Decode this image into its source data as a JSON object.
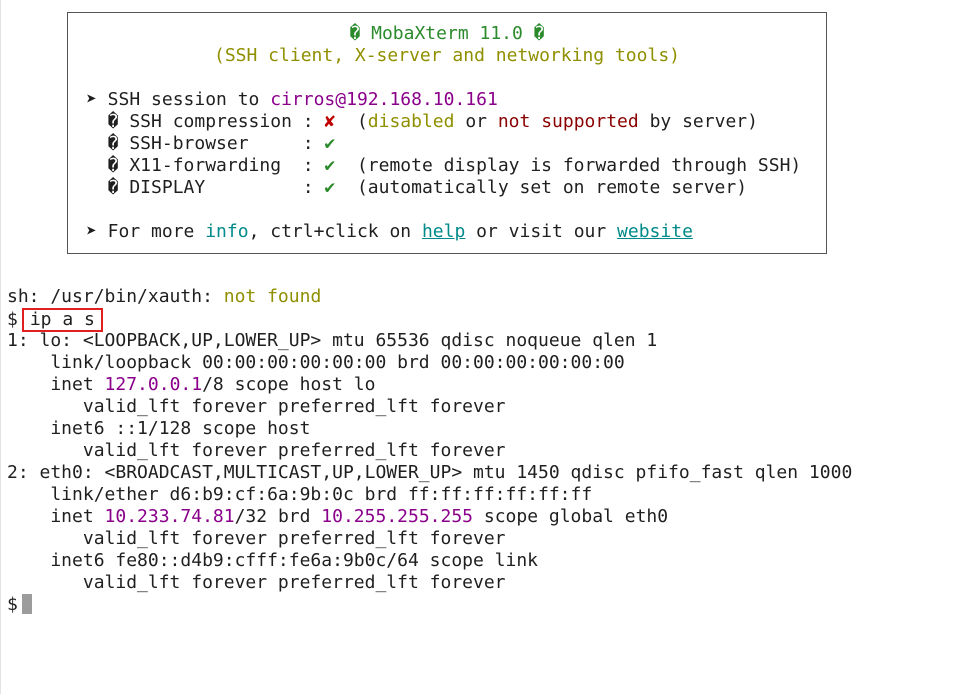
{
  "banner": {
    "title": "� MobaXterm 11.0 �",
    "subtitle": "(SSH client, X-server and networking tools)",
    "ssh": {
      "prefix": "➤ SSH session to ",
      "user": "cirros",
      "host": "@192.168.10.161"
    },
    "compression": {
      "label": "  � SSH compression : ",
      "mark": "✘",
      "open": "  (",
      "w1": "disabled",
      "or": " or ",
      "w2": "not",
      "sp": " ",
      "w3": "supported",
      "end": " by server)"
    },
    "browser": {
      "label": "  � SSH-browser     : ",
      "mark": "✔"
    },
    "x11": {
      "label": "  � X11-forwarding  : ",
      "mark": "✔",
      "desc": "  (remote display is forwarded through SSH)"
    },
    "display": {
      "label": "  � DISPLAY         : ",
      "mark": "✔",
      "desc": "  (automatically set on remote server)"
    },
    "more": {
      "prefix": "➤ For more ",
      "info": "info",
      "mid": ", ctrl+click on ",
      "help": "help",
      "mid2": " or visit our ",
      "website": "website"
    }
  },
  "terminal": {
    "xauth": {
      "text": "sh: /usr/bin/xauth: ",
      "status": "not found"
    },
    "prompt": "$",
    "command": "ip a s",
    "out1": "1: lo: <LOOPBACK,UP,LOWER_UP> mtu 65536 qdisc noqueue qlen 1",
    "out2": "    link/loopback 00:00:00:00:00:00 brd 00:00:00:00:00:00",
    "out3": {
      "pre": "    inet ",
      "ip": "127.0.0.1",
      "post": "/8 scope host lo"
    },
    "out4": "       valid_lft forever preferred_lft forever",
    "out5": "    inet6 ::1/128 scope host",
    "out6": "       valid_lft forever preferred_lft forever",
    "out7": "2: eth0: <BROADCAST,MULTICAST,UP,LOWER_UP> mtu 1450 qdisc pfifo_fast qlen 1000",
    "out8": "    link/ether d6:b9:cf:6a:9b:0c brd ff:ff:ff:ff:ff:ff",
    "out9": {
      "pre": "    inet ",
      "ip": "10.233.74.81",
      "mid": "/32 brd ",
      "brd": "10.255.255.255",
      "post": " scope global eth0"
    },
    "out10": "       valid_lft forever preferred_lft forever",
    "out11": "    inet6 fe80::d4b9:cfff:fe6a:9b0c/64 scope link",
    "out12": "       valid_lft forever preferred_lft forever",
    "final_prompt": "$"
  },
  "colors": {
    "highlight_box": "#e02020",
    "cursor": "#9c9c9c"
  }
}
